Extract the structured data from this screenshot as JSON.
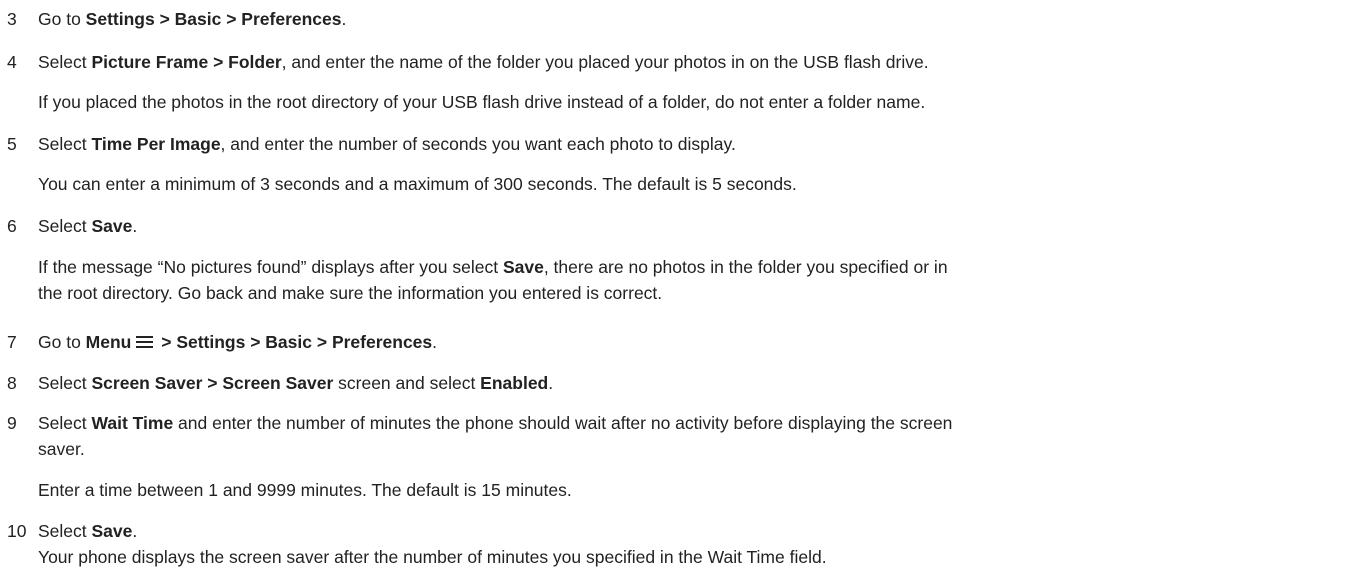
{
  "steps": [
    {
      "number": "3",
      "text_pre": "Go to ",
      "bold1": "Settings > Basic > Preferences",
      "text_post": "."
    },
    {
      "number": "4",
      "text_pre": "Select ",
      "bold1": "Picture Frame > Folder",
      "text_post": ", and enter the name of the folder you placed your photos in on the USB flash drive.",
      "note": "If you placed the photos in the root directory of your USB flash drive instead of a folder, do not enter a folder name."
    },
    {
      "number": "5",
      "text_pre": "Select ",
      "bold1": "Time Per Image",
      "text_post": ", and enter the number of seconds you want each photo to display.",
      "note": "You can enter a minimum of 3 seconds and a maximum of 300 seconds. The default is 5 seconds."
    },
    {
      "number": "6",
      "text_pre": "Select ",
      "bold1": "Save",
      "text_post": ".",
      "note_pre": "If the message “No pictures found” displays after you select ",
      "note_bold": "Save",
      "note_post": ", there are no photos in the folder you specified or in",
      "note_line2": "the root directory. Go back and make sure the information you entered is correct."
    },
    {
      "number": "7",
      "text_pre": "Go to ",
      "bold1": "Menu",
      "icon": "menu-icon",
      "bold2": " > Settings > Basic > Preferences",
      "text_post": "."
    },
    {
      "number": "8",
      "text_pre": "Select ",
      "bold1": "Screen Saver > Screen Saver",
      "text_mid": " screen and select ",
      "bold2": "Enabled",
      "text_post": "."
    },
    {
      "number": "9",
      "text_pre": "Select ",
      "bold1": "Wait Time",
      "text_post": " and enter the number of minutes the phone should wait after no activity before displaying the screen",
      "text_line2": "saver.",
      "note": "Enter a time between 1 and 9999 minutes. The default is 15 minutes."
    },
    {
      "number": "10",
      "text_pre": "Select ",
      "bold1": "Save",
      "text_post": ".",
      "note": "Your phone displays the screen saver after the number of minutes you specified in the Wait Time field."
    }
  ]
}
